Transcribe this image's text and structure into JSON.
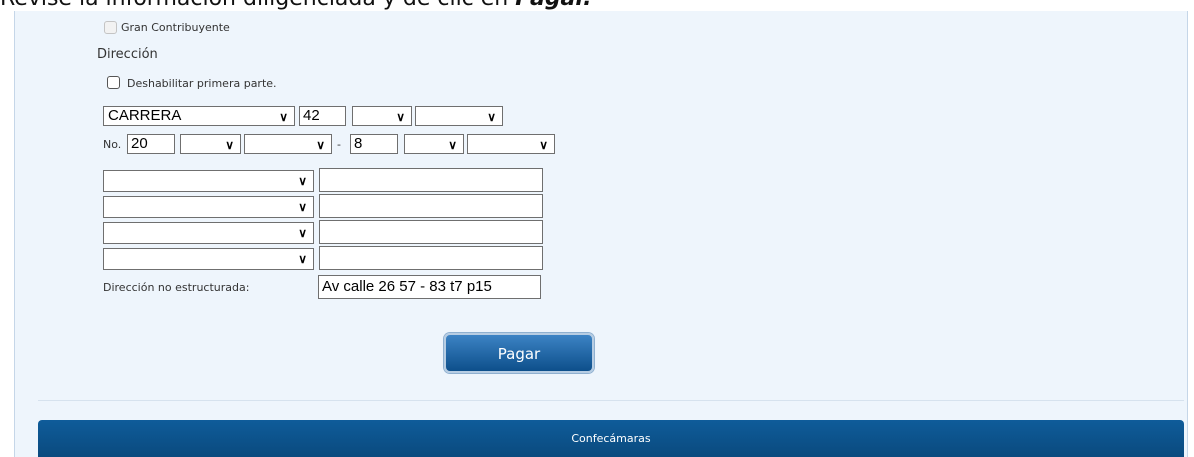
{
  "header": {
    "instruction_prefix": "Revise la información diligenciada y dé clic en ",
    "instruction_bold": "Pagar."
  },
  "form": {
    "gran_contribuyente_label": "Gran Contribuyente",
    "direccion_label": "Dirección",
    "deshabilitar_label": "Deshabilitar primera parte.",
    "via_tipo": "CARRERA",
    "via_numero": "42",
    "via_letra": "",
    "via_bis": "",
    "no_label": "No.",
    "numero": "20",
    "numero_letra": "",
    "numero_bis": "",
    "dash": "-",
    "placa": "8",
    "placa_letra": "",
    "placa_cuadrante": "",
    "complementos": [
      {
        "tipo": "",
        "valor": ""
      },
      {
        "tipo": "",
        "valor": ""
      },
      {
        "tipo": "",
        "valor": ""
      },
      {
        "tipo": "",
        "valor": ""
      }
    ],
    "no_estructurada_label": "Dirección no estructurada:",
    "no_estructurada_value": "Av calle 26 57 - 83 t7 p15"
  },
  "actions": {
    "pagar_label": "Pagar"
  },
  "footer": {
    "text": "Confecámaras"
  },
  "colors": {
    "panel_bg": "#eef5fc",
    "button_blue": "#0d4f8b",
    "footer_blue": "#0a4a7e"
  }
}
